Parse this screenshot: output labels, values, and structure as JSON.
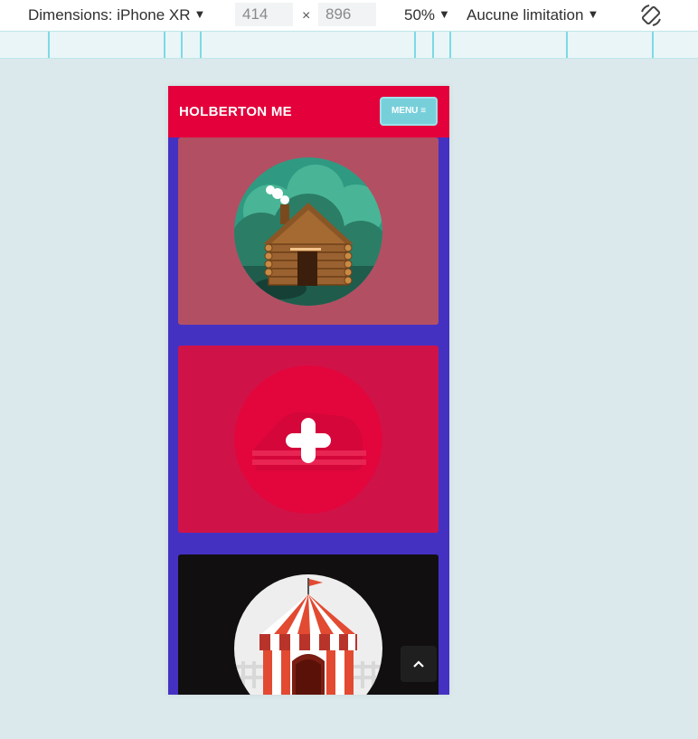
{
  "toolbar": {
    "device_label": "Dimensions: iPhone XR",
    "width_value": "414",
    "times_symbol": "×",
    "height_value": "896",
    "zoom_label": "50%",
    "throttle_label": "Aucune limitation",
    "icons": [
      "caret-down-icon",
      "rotate-icon"
    ]
  },
  "site": {
    "brand": "HOLBERTON ME",
    "menu_label": "MENU",
    "menu_icon": "hamburger-icon",
    "cards": [
      {
        "image": "log-cabin-illustration",
        "bg": "#b34f63"
      },
      {
        "image": "plus-sled-illustration",
        "bg": "#cf1349"
      },
      {
        "image": "circus-tent-illustration",
        "bg": "#120f10"
      }
    ],
    "scroll_top_icon": "chevron-up-icon"
  },
  "colors": {
    "header": "#e3003b",
    "page_bg": "#4431c2",
    "menu_button": "#77cfda"
  }
}
